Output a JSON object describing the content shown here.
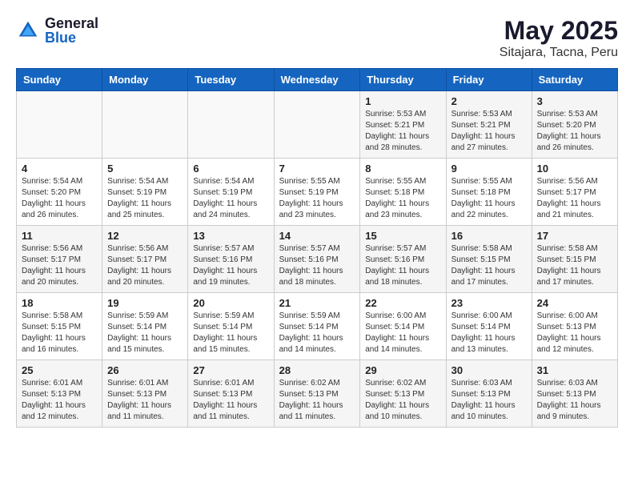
{
  "header": {
    "logo_general": "General",
    "logo_blue": "Blue",
    "month_year": "May 2025",
    "location": "Sitajara, Tacna, Peru"
  },
  "days_of_week": [
    "Sunday",
    "Monday",
    "Tuesday",
    "Wednesday",
    "Thursday",
    "Friday",
    "Saturday"
  ],
  "weeks": [
    [
      {
        "day": "",
        "info": ""
      },
      {
        "day": "",
        "info": ""
      },
      {
        "day": "",
        "info": ""
      },
      {
        "day": "",
        "info": ""
      },
      {
        "day": "1",
        "info": "Sunrise: 5:53 AM\nSunset: 5:21 PM\nDaylight: 11 hours\nand 28 minutes."
      },
      {
        "day": "2",
        "info": "Sunrise: 5:53 AM\nSunset: 5:21 PM\nDaylight: 11 hours\nand 27 minutes."
      },
      {
        "day": "3",
        "info": "Sunrise: 5:53 AM\nSunset: 5:20 PM\nDaylight: 11 hours\nand 26 minutes."
      }
    ],
    [
      {
        "day": "4",
        "info": "Sunrise: 5:54 AM\nSunset: 5:20 PM\nDaylight: 11 hours\nand 26 minutes."
      },
      {
        "day": "5",
        "info": "Sunrise: 5:54 AM\nSunset: 5:19 PM\nDaylight: 11 hours\nand 25 minutes."
      },
      {
        "day": "6",
        "info": "Sunrise: 5:54 AM\nSunset: 5:19 PM\nDaylight: 11 hours\nand 24 minutes."
      },
      {
        "day": "7",
        "info": "Sunrise: 5:55 AM\nSunset: 5:19 PM\nDaylight: 11 hours\nand 23 minutes."
      },
      {
        "day": "8",
        "info": "Sunrise: 5:55 AM\nSunset: 5:18 PM\nDaylight: 11 hours\nand 23 minutes."
      },
      {
        "day": "9",
        "info": "Sunrise: 5:55 AM\nSunset: 5:18 PM\nDaylight: 11 hours\nand 22 minutes."
      },
      {
        "day": "10",
        "info": "Sunrise: 5:56 AM\nSunset: 5:17 PM\nDaylight: 11 hours\nand 21 minutes."
      }
    ],
    [
      {
        "day": "11",
        "info": "Sunrise: 5:56 AM\nSunset: 5:17 PM\nDaylight: 11 hours\nand 20 minutes."
      },
      {
        "day": "12",
        "info": "Sunrise: 5:56 AM\nSunset: 5:17 PM\nDaylight: 11 hours\nand 20 minutes."
      },
      {
        "day": "13",
        "info": "Sunrise: 5:57 AM\nSunset: 5:16 PM\nDaylight: 11 hours\nand 19 minutes."
      },
      {
        "day": "14",
        "info": "Sunrise: 5:57 AM\nSunset: 5:16 PM\nDaylight: 11 hours\nand 18 minutes."
      },
      {
        "day": "15",
        "info": "Sunrise: 5:57 AM\nSunset: 5:16 PM\nDaylight: 11 hours\nand 18 minutes."
      },
      {
        "day": "16",
        "info": "Sunrise: 5:58 AM\nSunset: 5:15 PM\nDaylight: 11 hours\nand 17 minutes."
      },
      {
        "day": "17",
        "info": "Sunrise: 5:58 AM\nSunset: 5:15 PM\nDaylight: 11 hours\nand 17 minutes."
      }
    ],
    [
      {
        "day": "18",
        "info": "Sunrise: 5:58 AM\nSunset: 5:15 PM\nDaylight: 11 hours\nand 16 minutes."
      },
      {
        "day": "19",
        "info": "Sunrise: 5:59 AM\nSunset: 5:14 PM\nDaylight: 11 hours\nand 15 minutes."
      },
      {
        "day": "20",
        "info": "Sunrise: 5:59 AM\nSunset: 5:14 PM\nDaylight: 11 hours\nand 15 minutes."
      },
      {
        "day": "21",
        "info": "Sunrise: 5:59 AM\nSunset: 5:14 PM\nDaylight: 11 hours\nand 14 minutes."
      },
      {
        "day": "22",
        "info": "Sunrise: 6:00 AM\nSunset: 5:14 PM\nDaylight: 11 hours\nand 14 minutes."
      },
      {
        "day": "23",
        "info": "Sunrise: 6:00 AM\nSunset: 5:14 PM\nDaylight: 11 hours\nand 13 minutes."
      },
      {
        "day": "24",
        "info": "Sunrise: 6:00 AM\nSunset: 5:13 PM\nDaylight: 11 hours\nand 12 minutes."
      }
    ],
    [
      {
        "day": "25",
        "info": "Sunrise: 6:01 AM\nSunset: 5:13 PM\nDaylight: 11 hours\nand 12 minutes."
      },
      {
        "day": "26",
        "info": "Sunrise: 6:01 AM\nSunset: 5:13 PM\nDaylight: 11 hours\nand 11 minutes."
      },
      {
        "day": "27",
        "info": "Sunrise: 6:01 AM\nSunset: 5:13 PM\nDaylight: 11 hours\nand 11 minutes."
      },
      {
        "day": "28",
        "info": "Sunrise: 6:02 AM\nSunset: 5:13 PM\nDaylight: 11 hours\nand 11 minutes."
      },
      {
        "day": "29",
        "info": "Sunrise: 6:02 AM\nSunset: 5:13 PM\nDaylight: 11 hours\nand 10 minutes."
      },
      {
        "day": "30",
        "info": "Sunrise: 6:03 AM\nSunset: 5:13 PM\nDaylight: 11 hours\nand 10 minutes."
      },
      {
        "day": "31",
        "info": "Sunrise: 6:03 AM\nSunset: 5:13 PM\nDaylight: 11 hours\nand 9 minutes."
      }
    ]
  ]
}
